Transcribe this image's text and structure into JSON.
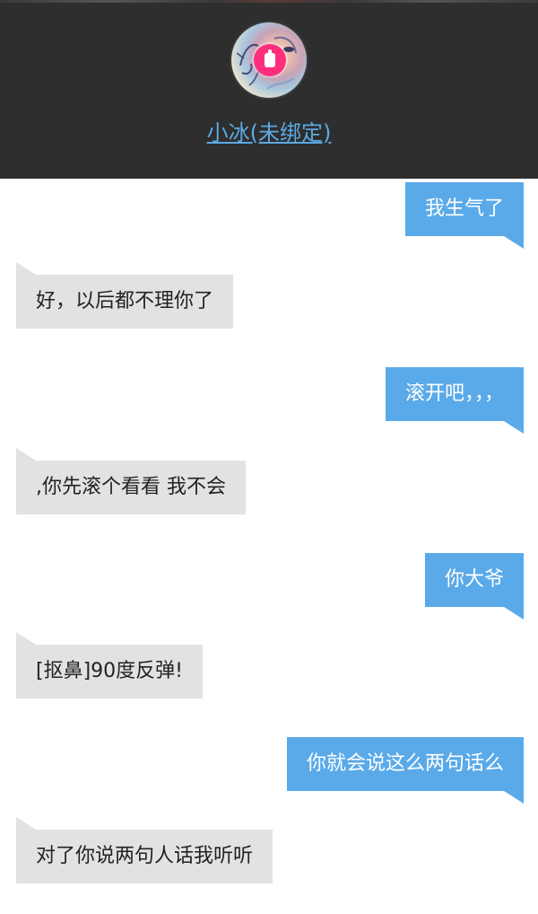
{
  "header": {
    "contact_name": "小冰(未绑定)",
    "avatar_icon": "avatar-image",
    "badge_icon": "pink-app-logo",
    "accent_color": "#5aaae3",
    "background_color": "#2e2e2e"
  },
  "messages": [
    {
      "side": "right",
      "text": "我生气了"
    },
    {
      "side": "left",
      "text": "好，以后都不理你了"
    },
    {
      "side": "right",
      "text": "滚开吧，，，"
    },
    {
      "side": "left",
      "text": ",你先滚个看看 我不会"
    },
    {
      "side": "right",
      "text": "你大爷"
    },
    {
      "side": "left",
      "text": "[抠鼻]90度反弹!"
    },
    {
      "side": "right",
      "text": "你就会说这么两句话么"
    },
    {
      "side": "left",
      "text": "对了你说两句人话我听听"
    }
  ],
  "colors": {
    "outgoing_bubble": "#5aaae9",
    "incoming_bubble": "#e2e2e2"
  }
}
